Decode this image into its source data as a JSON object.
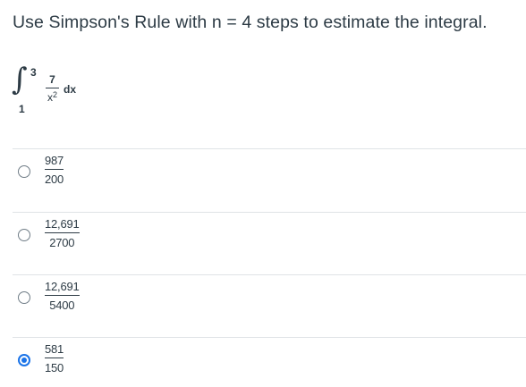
{
  "question": {
    "text": "Use Simpson's Rule with n = 4 steps to estimate the integral."
  },
  "integral": {
    "upper": "3",
    "lower": "1",
    "numerator": "7",
    "denominator_base": "x",
    "denominator_exp": "2",
    "differential": "dx"
  },
  "options": [
    {
      "numerator": "987",
      "denominator": "200",
      "selected": false
    },
    {
      "numerator": "12,691",
      "denominator": "2700",
      "selected": false
    },
    {
      "numerator": "12,691",
      "denominator": "5400",
      "selected": false
    },
    {
      "numerator": "581",
      "denominator": "150",
      "selected": true
    }
  ],
  "colors": {
    "text": "#2d3b45",
    "divider": "#dfe3e6",
    "radio_selected": "#1a73e8"
  }
}
